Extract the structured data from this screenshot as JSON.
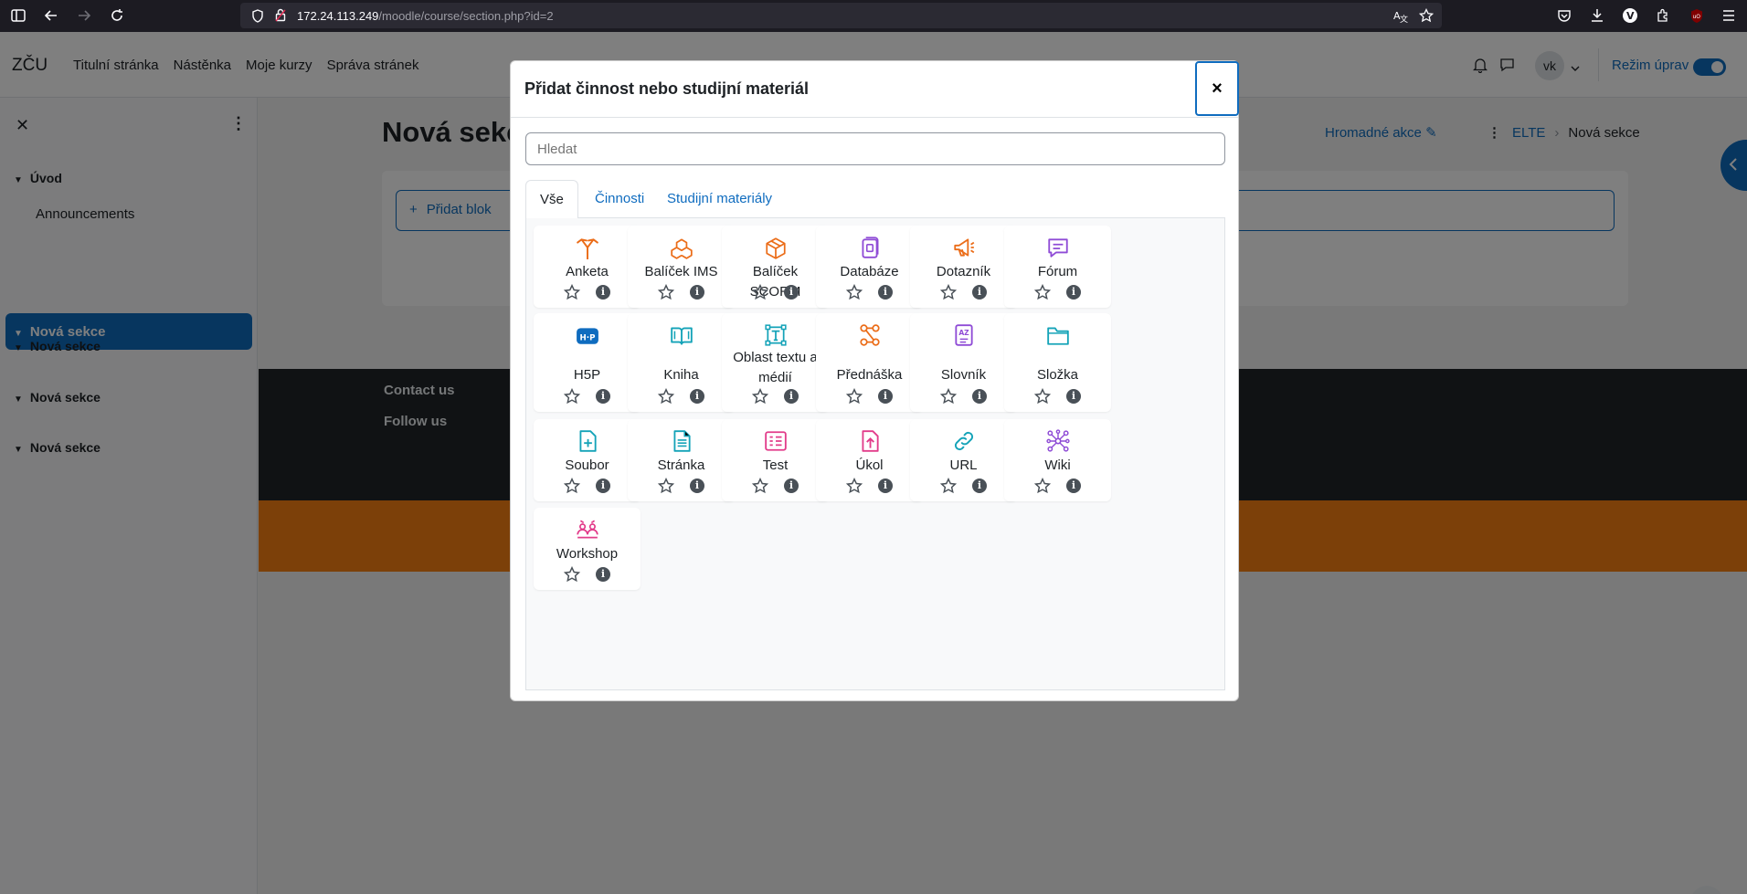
{
  "browser": {
    "url_host": "172.24.113.249",
    "url_path": "/moodle/course/section.php?id=2"
  },
  "navbar": {
    "brand": "ZČU",
    "links": [
      "Titulní stránka",
      "Nástěnka",
      "Moje kurzy",
      "Správa stránek"
    ],
    "avatar_initials": "vk",
    "edit_mode_label": "Režim úprav"
  },
  "drawer": {
    "sections": [
      {
        "label": "Úvod"
      },
      {
        "label": "Announcements"
      },
      {
        "label": "Nová sekce"
      },
      {
        "label": "Nová sekce"
      },
      {
        "label": "Nová sekce"
      },
      {
        "label": "Nová sekce"
      }
    ]
  },
  "content": {
    "title": "Nová sekc",
    "bulk_actions": "Hromadné akce",
    "breadcrumb": [
      "ELTE",
      "Nová sekce"
    ],
    "add_block": "Přidat blok"
  },
  "footer": {
    "contact": "Contact us",
    "follow": "Follow us"
  },
  "modal": {
    "title": "Přidat činnost nebo studijní materiál",
    "close_glyph": "×",
    "search_placeholder": "Hledat",
    "tabs": [
      "Vše",
      "Činnosti",
      "Studijní materiály"
    ],
    "items": [
      {
        "label": "Anketa",
        "icon": "choice-icon",
        "color": "#eb6d19"
      },
      {
        "label": "Balíček IMS",
        "icon": "ims-package-icon",
        "color": "#eb6d19"
      },
      {
        "label": "Balíček SCORM",
        "icon": "scorm-package-icon",
        "color": "#eb6d19"
      },
      {
        "label": "Databáze",
        "icon": "database-icon",
        "color": "#8f4cd6"
      },
      {
        "label": "Dotazník",
        "icon": "feedback-icon",
        "color": "#eb6d19"
      },
      {
        "label": "Fórum",
        "icon": "forum-icon",
        "color": "#8f4cd6"
      },
      {
        "label": "H5P",
        "icon": "h5p-icon",
        "color": "#0f6cbf"
      },
      {
        "label": "Kniha",
        "icon": "book-icon",
        "color": "#14a3b8"
      },
      {
        "label": "Oblast textu a médií",
        "icon": "text-media-icon",
        "color": "#14a3b8"
      },
      {
        "label": "Přednáška",
        "icon": "lesson-icon",
        "color": "#eb6d19"
      },
      {
        "label": "Slovník",
        "icon": "glossary-icon",
        "color": "#8f4cd6"
      },
      {
        "label": "Složka",
        "icon": "folder-icon",
        "color": "#14a3b8"
      },
      {
        "label": "Soubor",
        "icon": "file-icon",
        "color": "#14a3b8"
      },
      {
        "label": "Stránka",
        "icon": "page-icon",
        "color": "#14a3b8"
      },
      {
        "label": "Test",
        "icon": "quiz-icon",
        "color": "#e23c8a"
      },
      {
        "label": "Úkol",
        "icon": "assignment-icon",
        "color": "#e23c8a"
      },
      {
        "label": "URL",
        "icon": "url-icon",
        "color": "#14a3b8"
      },
      {
        "label": "Wiki",
        "icon": "wiki-icon",
        "color": "#8f4cd6"
      },
      {
        "label": "Workshop",
        "icon": "workshop-icon",
        "color": "#e23c8a"
      }
    ]
  }
}
